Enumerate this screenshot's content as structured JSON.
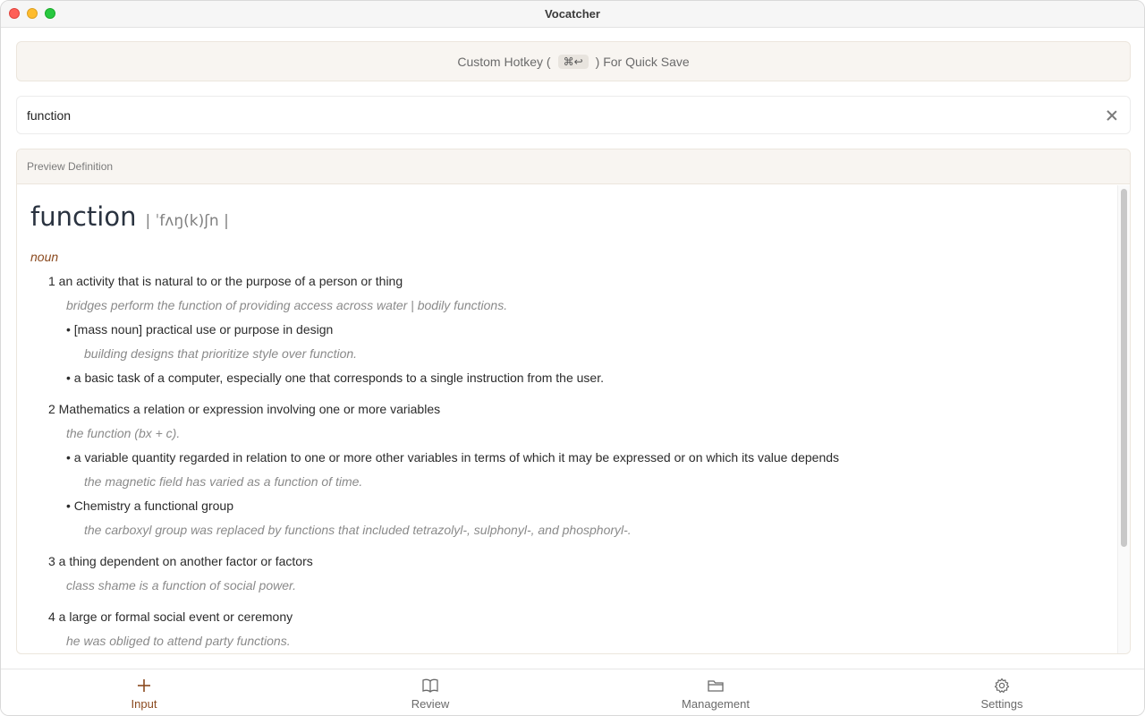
{
  "window": {
    "title": "Vocatcher"
  },
  "hotkey": {
    "prefix": "Custom Hotkey (",
    "key": "⌘↩",
    "suffix": ") For Quick Save"
  },
  "search": {
    "value": "function"
  },
  "preview": {
    "header": "Preview Definition",
    "headword": "function",
    "pronunciation": "| ˈfʌŋ(k)ʃn |",
    "pos": "noun",
    "s1": "1 an activity that is natural to or the purpose of a person or thing",
    "s1_ex": "bridges perform the function of providing access across water | bodily functions.",
    "s1a": "• [mass noun] practical use or purpose in design",
    "s1a_ex": "building designs that prioritize style over function.",
    "s1b": "• a basic task of a computer, especially one that corresponds to a single instruction from the user.",
    "s2": "2 Mathematics a relation or expression involving one or more variables",
    "s2_ex": "the function (bx + c).",
    "s2a": "• a variable quantity regarded in relation to one or more other variables in terms of which it may be expressed or on which its value depends",
    "s2a_ex": "the magnetic field has varied as a function of time.",
    "s2b": "• Chemistry a functional group",
    "s2b_ex": "the carboxyl group was replaced by functions that included tetrazolyl-, sulphonyl-, and phosphoryl-.",
    "s3": "3 a thing dependent on another factor or factors",
    "s3_ex": "class shame is a function of social power.",
    "s4": "4 a large or formal social event or ceremony",
    "s4_ex": "he was obliged to attend party functions."
  },
  "tabs": {
    "input": {
      "label": "Input",
      "icon": "plus-icon"
    },
    "review": {
      "label": "Review",
      "icon": "book-icon"
    },
    "management": {
      "label": "Management",
      "icon": "folder-icon"
    },
    "settings": {
      "label": "Settings",
      "icon": "gear-icon"
    }
  },
  "colors": {
    "accent": "#8b4a1f",
    "banner_bg": "#f8f5f1"
  }
}
